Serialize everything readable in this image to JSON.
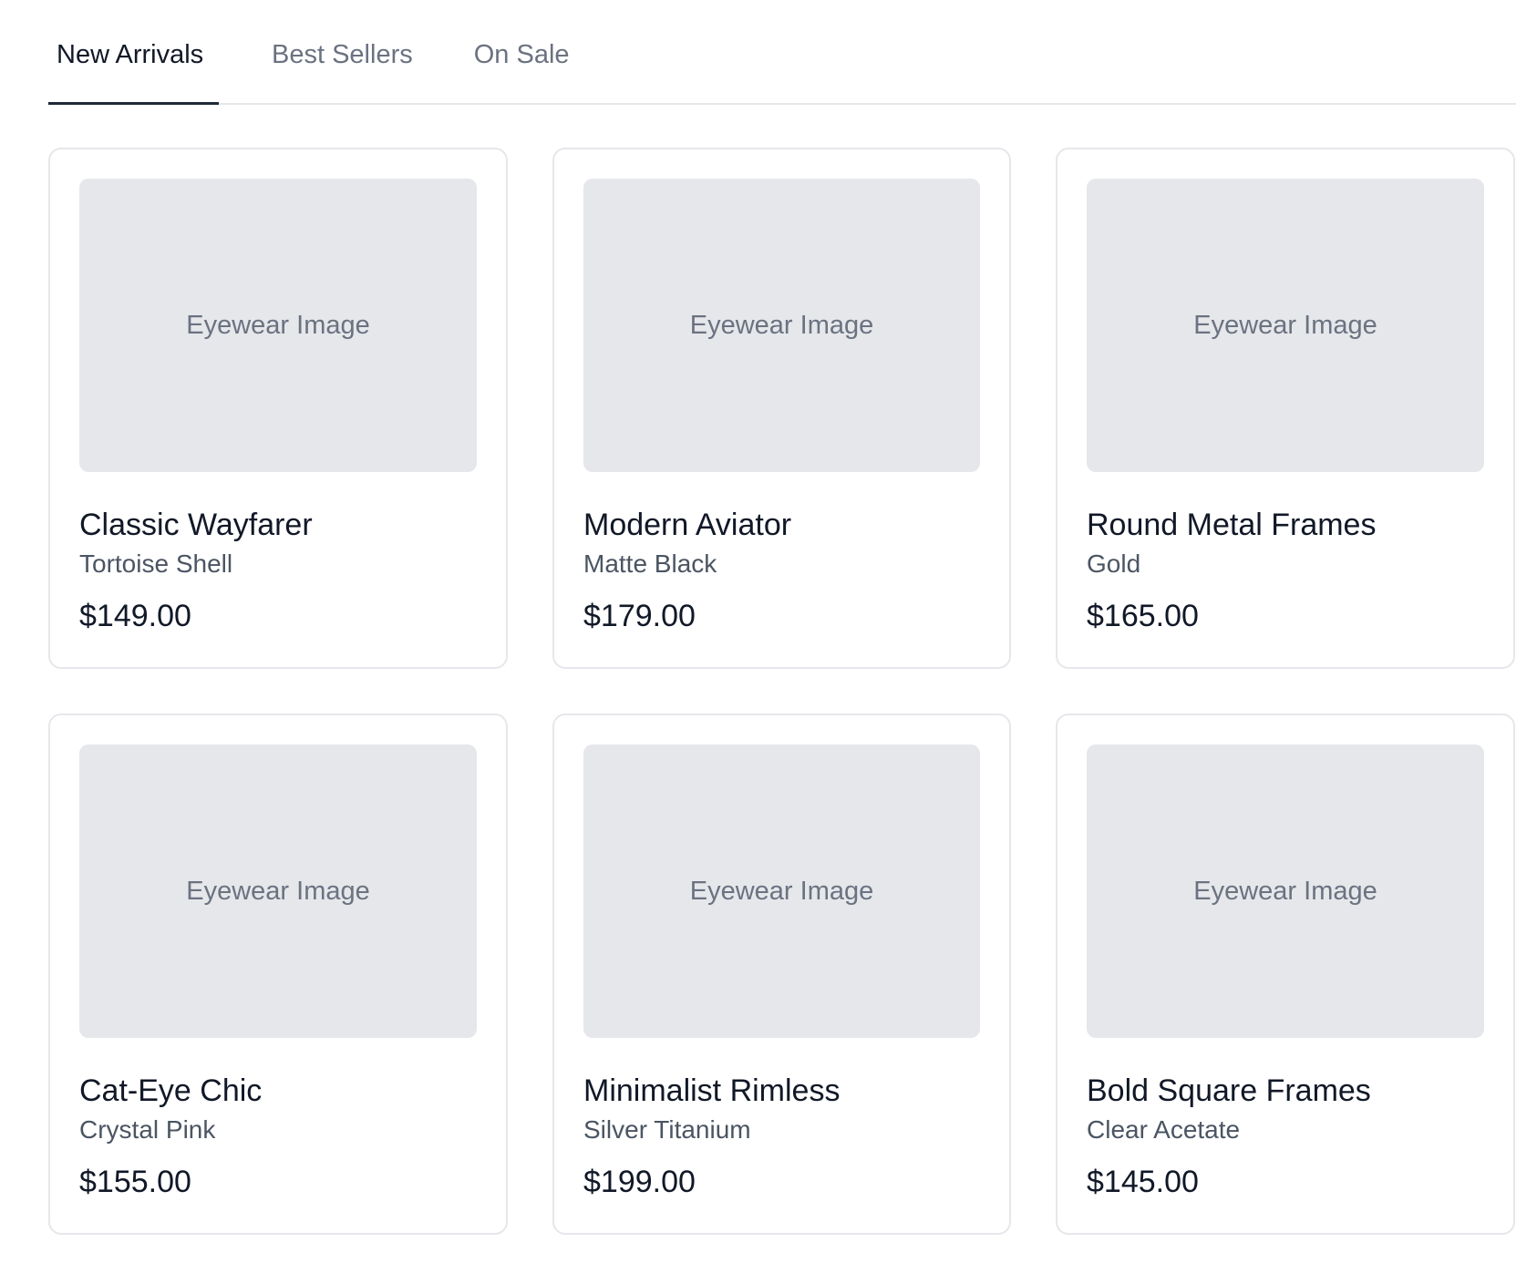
{
  "tabs": [
    {
      "label": "New Arrivals",
      "active": true
    },
    {
      "label": "Best Sellers",
      "active": false
    },
    {
      "label": "On Sale",
      "active": false
    }
  ],
  "products": [
    {
      "image_label": "Eyewear Image",
      "name": "Classic Wayfarer",
      "variant": "Tortoise Shell",
      "price": "$149.00"
    },
    {
      "image_label": "Eyewear Image",
      "name": "Modern Aviator",
      "variant": "Matte Black",
      "price": "$179.00"
    },
    {
      "image_label": "Eyewear Image",
      "name": "Round Metal Frames",
      "variant": "Gold",
      "price": "$165.00"
    },
    {
      "image_label": "Eyewear Image",
      "name": "Cat-Eye Chic",
      "variant": "Crystal Pink",
      "price": "$155.00"
    },
    {
      "image_label": "Eyewear Image",
      "name": "Minimalist Rimless",
      "variant": "Silver Titanium",
      "price": "$199.00"
    },
    {
      "image_label": "Eyewear Image",
      "name": "Bold Square Frames",
      "variant": "Clear Acetate",
      "price": "$145.00"
    }
  ],
  "colors": {
    "active_tab": "#111827",
    "inactive_tab": "#6b7280",
    "tab_underline": "#1f2937",
    "image_placeholder": "#e5e7eb",
    "card_border": "#e5e7eb"
  }
}
